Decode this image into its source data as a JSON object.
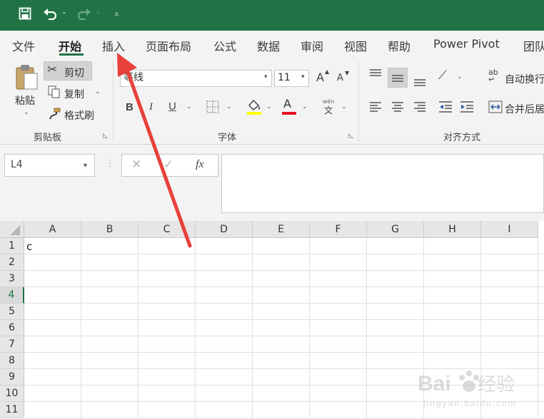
{
  "quick_access": {
    "save_icon": "save-icon",
    "undo_icon": "undo-icon",
    "redo_icon": "redo-icon",
    "customize_icon": "customize-qat-icon"
  },
  "tabs": [
    {
      "label": "文件"
    },
    {
      "label": "开始",
      "active": true
    },
    {
      "label": "插入"
    },
    {
      "label": "页面布局"
    },
    {
      "label": "公式"
    },
    {
      "label": "数据"
    },
    {
      "label": "审阅"
    },
    {
      "label": "视图"
    },
    {
      "label": "帮助"
    },
    {
      "label": "Power Pivot"
    },
    {
      "label": "团队"
    }
  ],
  "clipboard": {
    "paste_label": "粘贴",
    "cut_label": "剪切",
    "copy_label": "复制",
    "format_painter_label": "格式刷",
    "group_label": "剪贴板"
  },
  "font": {
    "font_name": "等线",
    "font_size": "11",
    "bold": "B",
    "italic": "I",
    "underline": "U",
    "font_color_glyph": "A",
    "grow_glyph": "A",
    "shrink_glyph": "A",
    "phonetic_top": "wén",
    "phonetic_bottom": "文",
    "group_label": "字体",
    "fill_color": "#ffff00",
    "font_color": "#e81123"
  },
  "alignment": {
    "wrap_text_label": "自动换行",
    "wrap_icon_text": "ab",
    "merge_label": "合并后居",
    "group_label": "对齐方式"
  },
  "formula_bar": {
    "name_box": "L4",
    "cancel_glyph": "✕",
    "enter_glyph": "✓",
    "fx_glyph": "fx",
    "formula_value": ""
  },
  "sheet": {
    "columns": [
      "A",
      "B",
      "C",
      "D",
      "E",
      "F",
      "G",
      "H",
      "I"
    ],
    "rows": [
      "1",
      "2",
      "3",
      "4",
      "5",
      "6",
      "7",
      "8",
      "9",
      "10",
      "11"
    ],
    "selected_row": "4",
    "cells": {
      "A1": "c"
    }
  },
  "colors": {
    "title_bar": "#217346",
    "accent": "#217346",
    "arrow": "#e8403a"
  }
}
